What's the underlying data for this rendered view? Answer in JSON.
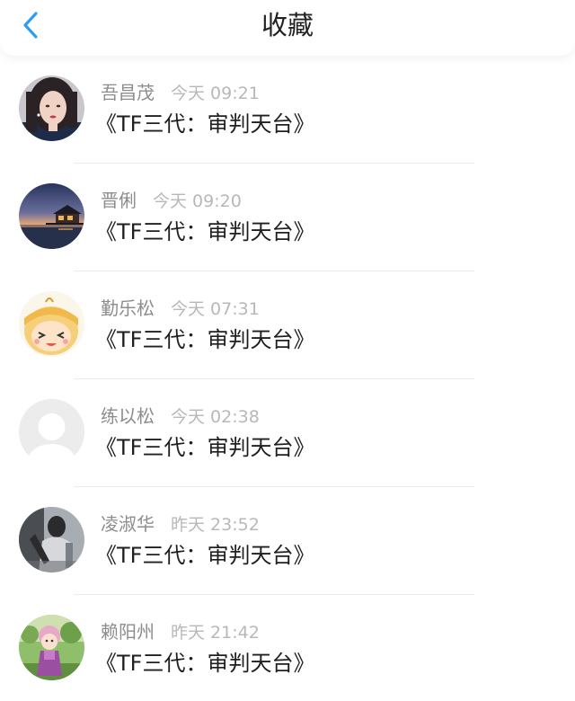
{
  "header": {
    "title": "收藏",
    "back_icon": "chevron-left-icon",
    "accent_color": "#2f9cf3"
  },
  "items": [
    {
      "name": "吾昌茂",
      "time": "今天 09:21",
      "content": "《TF三代：审判天台》",
      "avatar": "girl-portrait"
    },
    {
      "name": "晋俐",
      "time": "今天 09:20",
      "content": "《TF三代：审判天台》",
      "avatar": "sunset-water-villa"
    },
    {
      "name": "勤乐松",
      "time": "今天 07:31",
      "content": "《TF三代：审判天台》",
      "avatar": "cartoon-face"
    },
    {
      "name": "练以松",
      "time": "今天 02:38",
      "content": "《TF三代：审判天台》",
      "avatar": "default-user"
    },
    {
      "name": "凌淑华",
      "time": "昨天 23:52",
      "content": "《TF三代：审判天台》",
      "avatar": "dark-figure-photo"
    },
    {
      "name": "赖阳州",
      "time": "昨天 21:42",
      "content": "《TF三代：审判天台》",
      "avatar": "doll-in-garden"
    }
  ]
}
